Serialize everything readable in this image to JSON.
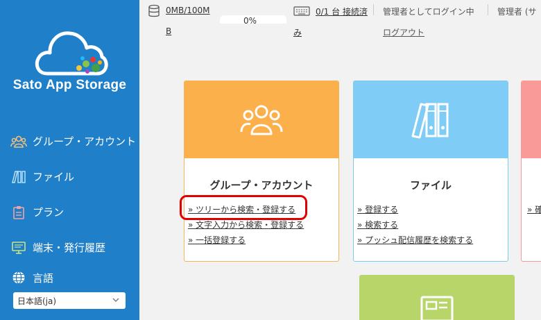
{
  "app": {
    "logo_text": "Sato App Storage"
  },
  "sidebar": {
    "items": [
      {
        "label": "グループ・アカウント",
        "icon": "group-icon"
      },
      {
        "label": "ファイル",
        "icon": "file-icon"
      },
      {
        "label": "プラン",
        "icon": "plan-icon"
      },
      {
        "label": "端末・発行履歴",
        "icon": "device-icon"
      }
    ],
    "language_label": "言語",
    "language_value": "日本語(ja)"
  },
  "header": {
    "storage_line1": "0MB/100M",
    "storage_line2": "B",
    "progress_label": "0%",
    "progress_percent": 0,
    "device_line1": "0/1 台 接続済",
    "device_line2": "み",
    "login_status": "管理者としてログイン中",
    "logout_label": "ログアウト",
    "admin_label": "管理者 (サ"
  },
  "cards": {
    "group": {
      "title": "グループ・アカウント",
      "links": [
        "» ツリーから検索・登録する",
        "» 文字入力から検索・登録する",
        "» 一括登録する"
      ]
    },
    "file": {
      "title": "ファイル",
      "links": [
        "» 登録する",
        "» 検索する",
        "» プッシュ配信履歴を検索する"
      ]
    },
    "third": {
      "links": [
        "» 確"
      ]
    }
  },
  "colors": {
    "sidebar": "#1f7fc9",
    "group_card": "#fbb04c",
    "file_card": "#7fcdf7",
    "third_card": "#fa9a98",
    "fourth_card": "#b8d56a",
    "highlight": "#e00000"
  }
}
